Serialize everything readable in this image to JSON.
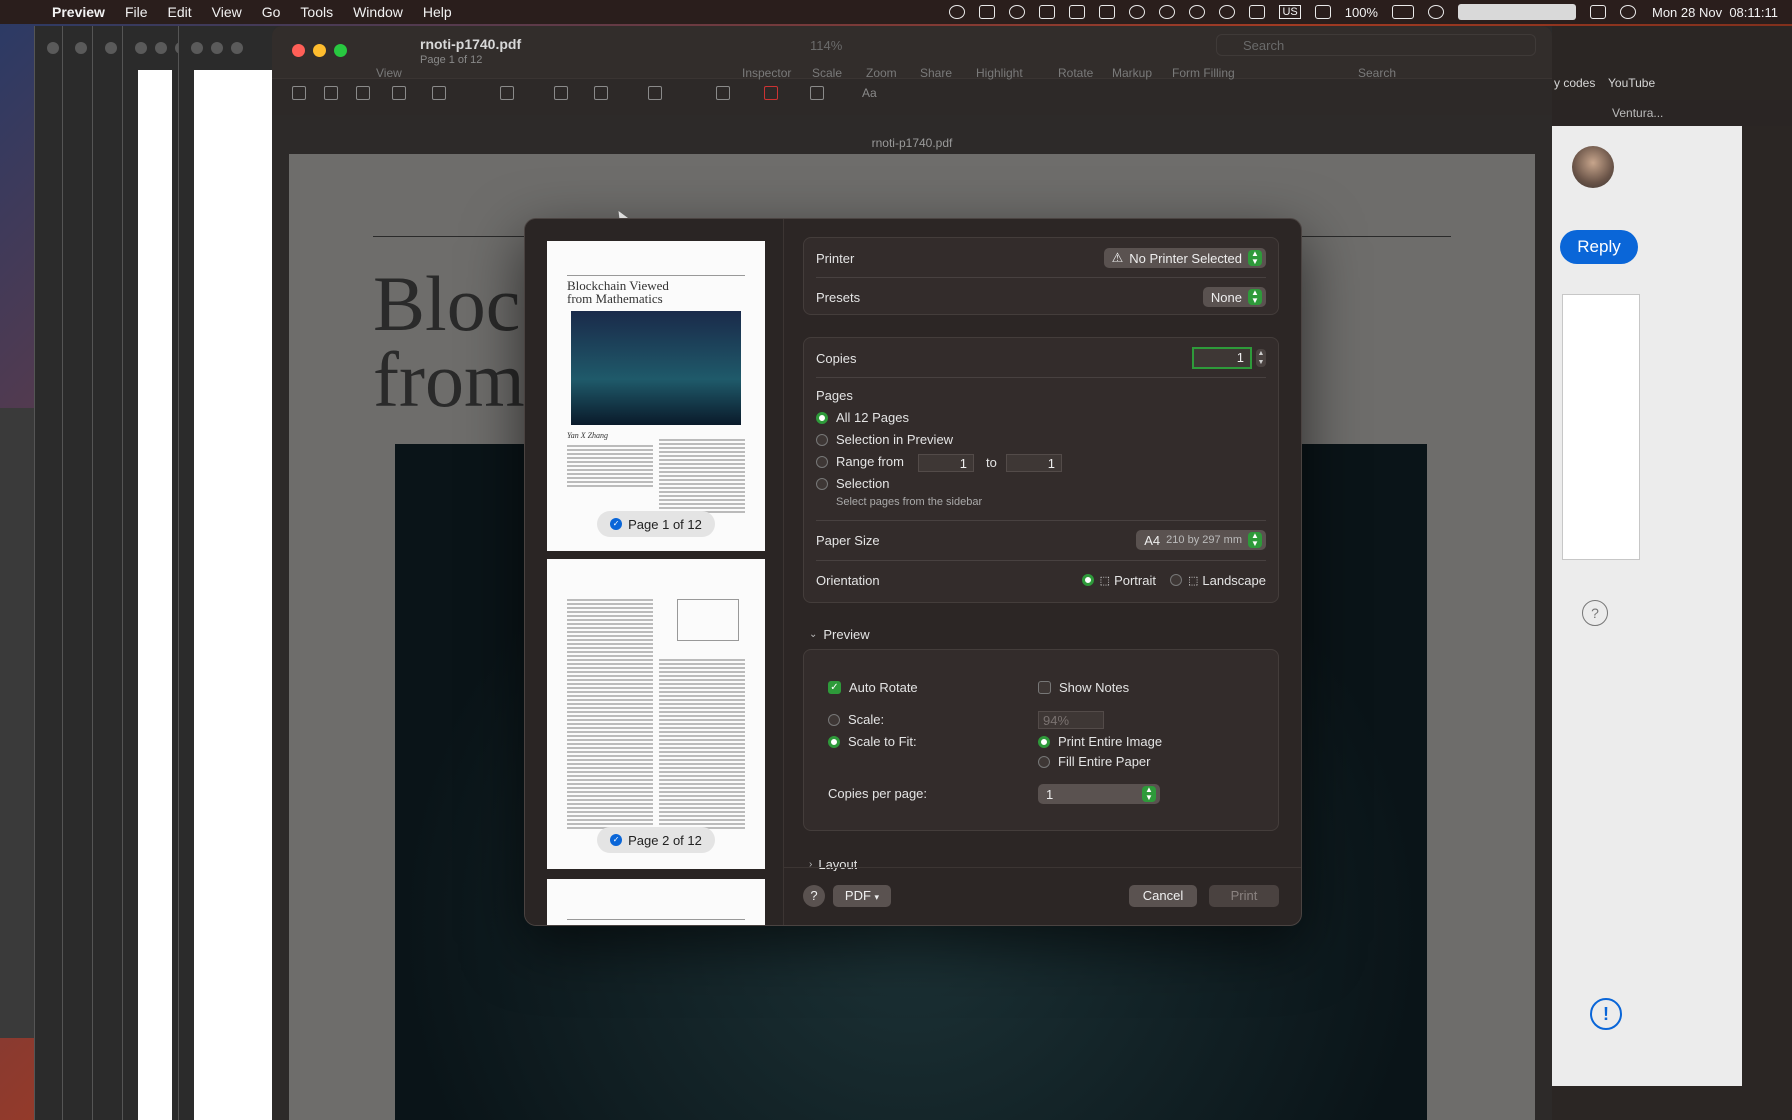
{
  "menubar": {
    "app": "Preview",
    "items": [
      "File",
      "Edit",
      "View",
      "Go",
      "Tools",
      "Window",
      "Help"
    ],
    "status": {
      "battery": "100%",
      "input": "US",
      "date": "Mon 28 Nov",
      "time": "08:11:11"
    }
  },
  "window": {
    "title": "rnoti-p1740.pdf",
    "subtitle": "Page 1 of 12",
    "toolbar": {
      "labels": [
        "View",
        "Inspector",
        "Scale",
        "Zoom",
        "Share",
        "Highlight",
        "Rotate",
        "Markup",
        "Form Filling",
        "Search"
      ],
      "zoom_value": "114%",
      "search_placeholder": "Search"
    },
    "filename_bar": "rnoti-p1740.pdf",
    "document": {
      "title_line1": "Bloc",
      "title_line2": "from"
    }
  },
  "side_window": {
    "links": [
      "y codes",
      "YouTube"
    ],
    "tabs": [
      "Ventura..."
    ],
    "reply_label": "Reply"
  },
  "print_dialog": {
    "thumbnails": [
      {
        "title_line1": "Blockchain Viewed",
        "title_line2": "from Mathematics",
        "author": "Yan X Zhang",
        "label": "Page 1 of 12"
      },
      {
        "label": "Page 2 of 12"
      }
    ],
    "printer": {
      "label": "Printer",
      "value": "No Printer Selected"
    },
    "presets": {
      "label": "Presets",
      "value": "None"
    },
    "copies": {
      "label": "Copies",
      "value": "1"
    },
    "pages": {
      "label": "Pages",
      "options": [
        "All 12 Pages",
        "Selection in Preview",
        "Range from",
        "Selection"
      ],
      "range_from": "1",
      "range_to_label": "to",
      "range_to": "1",
      "selection_hint": "Select pages from the sidebar",
      "selected": "All 12 Pages"
    },
    "paper_size": {
      "label": "Paper Size",
      "value": "A4",
      "detail": "210 by 297 mm"
    },
    "orientation": {
      "label": "Orientation",
      "portrait": "Portrait",
      "landscape": "Landscape",
      "selected": "Portrait"
    },
    "preview_section": {
      "title": "Preview",
      "auto_rotate": "Auto Rotate",
      "show_notes": "Show Notes",
      "scale_label": "Scale:",
      "scale_value": "94%",
      "scale_to_fit": "Scale to Fit:",
      "print_entire_image": "Print Entire Image",
      "fill_entire_paper": "Fill Entire Paper",
      "copies_per_page_label": "Copies per page:",
      "copies_per_page": "1"
    },
    "layout_section": "Layout",
    "footer": {
      "help": "?",
      "pdf": "PDF",
      "cancel": "Cancel",
      "print": "Print"
    }
  }
}
